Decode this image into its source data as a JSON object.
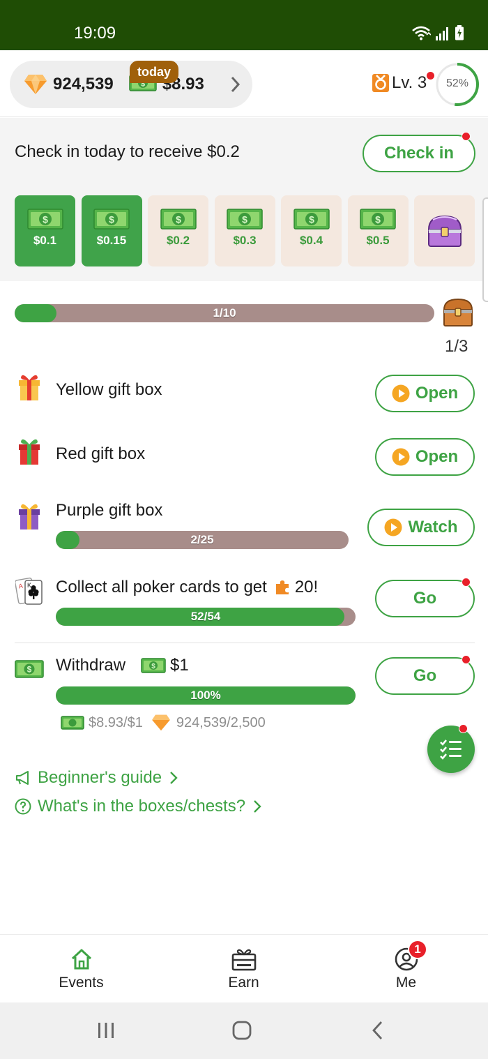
{
  "status_bar": {
    "time": "19:09"
  },
  "header": {
    "gems": "924,539",
    "cash": "$8.93",
    "level": "Lv. 3",
    "level_progress_text": "52%",
    "level_progress": 0.52
  },
  "checkin": {
    "prompt": "Check in today to receive $0.2",
    "button": "Check in",
    "today_tag": "today",
    "days": [
      {
        "amount": "$0.1",
        "claimed": true
      },
      {
        "amount": "$0.15",
        "claimed": true
      },
      {
        "amount": "$0.2",
        "claimed": false
      },
      {
        "amount": "$0.3",
        "claimed": false
      },
      {
        "amount": "$0.4",
        "claimed": false
      },
      {
        "amount": "$0.5",
        "claimed": false
      },
      {
        "amount": "",
        "claimed": false,
        "icon": "treasure-chest-icon"
      }
    ]
  },
  "chest_progress": {
    "label": "1/10",
    "value": 0.1,
    "chest_count": "1/3"
  },
  "tasks": {
    "yellow": {
      "title": "Yellow gift box",
      "button": "Open"
    },
    "red": {
      "title": "Red gift box",
      "button": "Open"
    },
    "purple": {
      "title": "Purple gift box",
      "button": "Watch",
      "progress_label": "2/25",
      "progress": 0.08
    },
    "poker": {
      "title": "Collect all poker cards to get",
      "reward": "20!",
      "button": "Go",
      "progress_label": "52/54",
      "progress": 0.963
    },
    "withdraw": {
      "title": "Withdraw",
      "amount": "$1",
      "button": "Go",
      "progress_label": "100%",
      "progress": 1.0,
      "cash_req": "$8.93/$1",
      "gem_req": "924,539/2,500"
    }
  },
  "links": {
    "guide": "Beginner's guide",
    "boxes": "What's in the boxes/chests?"
  },
  "nav": {
    "events": "Events",
    "earn": "Earn",
    "me": "Me",
    "me_badge": "1"
  },
  "colors": {
    "brand_green": "#3ea344",
    "status_bar": "#1f4d05",
    "progress_track": "#a88d8a",
    "alert_red": "#e8202a",
    "today_tag": "#a0600b"
  }
}
